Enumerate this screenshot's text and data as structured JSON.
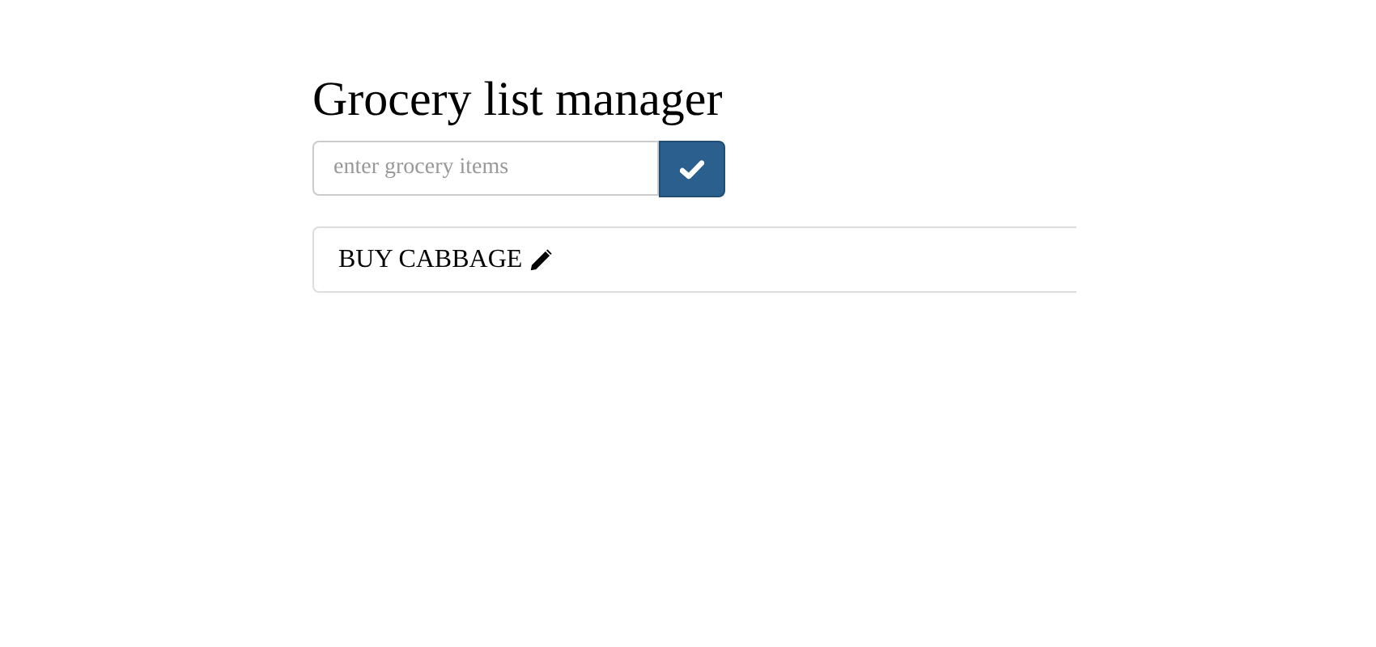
{
  "title": "Grocery list manager",
  "input": {
    "placeholder": "enter grocery items"
  },
  "items": [
    {
      "text": "BUY CABBAGE"
    }
  ]
}
